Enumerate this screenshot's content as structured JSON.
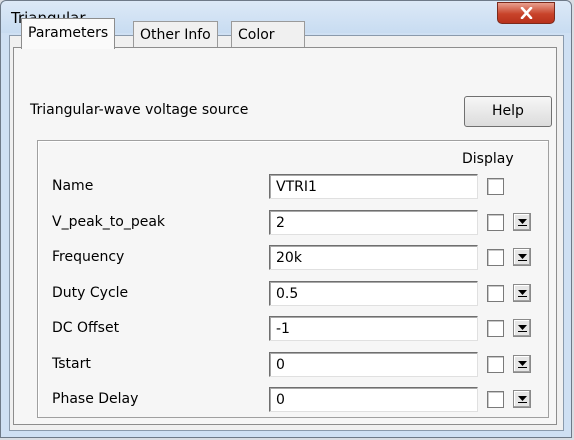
{
  "window": {
    "title": "Triangular"
  },
  "tabs": [
    {
      "label": "Parameters",
      "active": true
    },
    {
      "label": "Other Info",
      "active": false
    },
    {
      "label": "Color",
      "active": false
    }
  ],
  "panel": {
    "description": "Triangular-wave voltage source",
    "help_label": "Help",
    "display_header": "Display"
  },
  "rows": [
    {
      "label": "Name",
      "value": "VTRI1",
      "dropdown": false
    },
    {
      "label": "V_peak_to_peak",
      "value": "2",
      "dropdown": true
    },
    {
      "label": "Frequency",
      "value": "20k",
      "dropdown": true
    },
    {
      "label": "Duty Cycle",
      "value": "0.5",
      "dropdown": true
    },
    {
      "label": "DC Offset",
      "value": "-1",
      "dropdown": true
    },
    {
      "label": "Tstart",
      "value": "0",
      "dropdown": true
    },
    {
      "label": "Phase Delay",
      "value": "0",
      "dropdown": true
    }
  ],
  "icons": {
    "close": "close-icon",
    "dropdown": "chevron-down-icon"
  },
  "colors": {
    "close_button": "#c8432a",
    "title_bar": "#cfe0f3"
  }
}
